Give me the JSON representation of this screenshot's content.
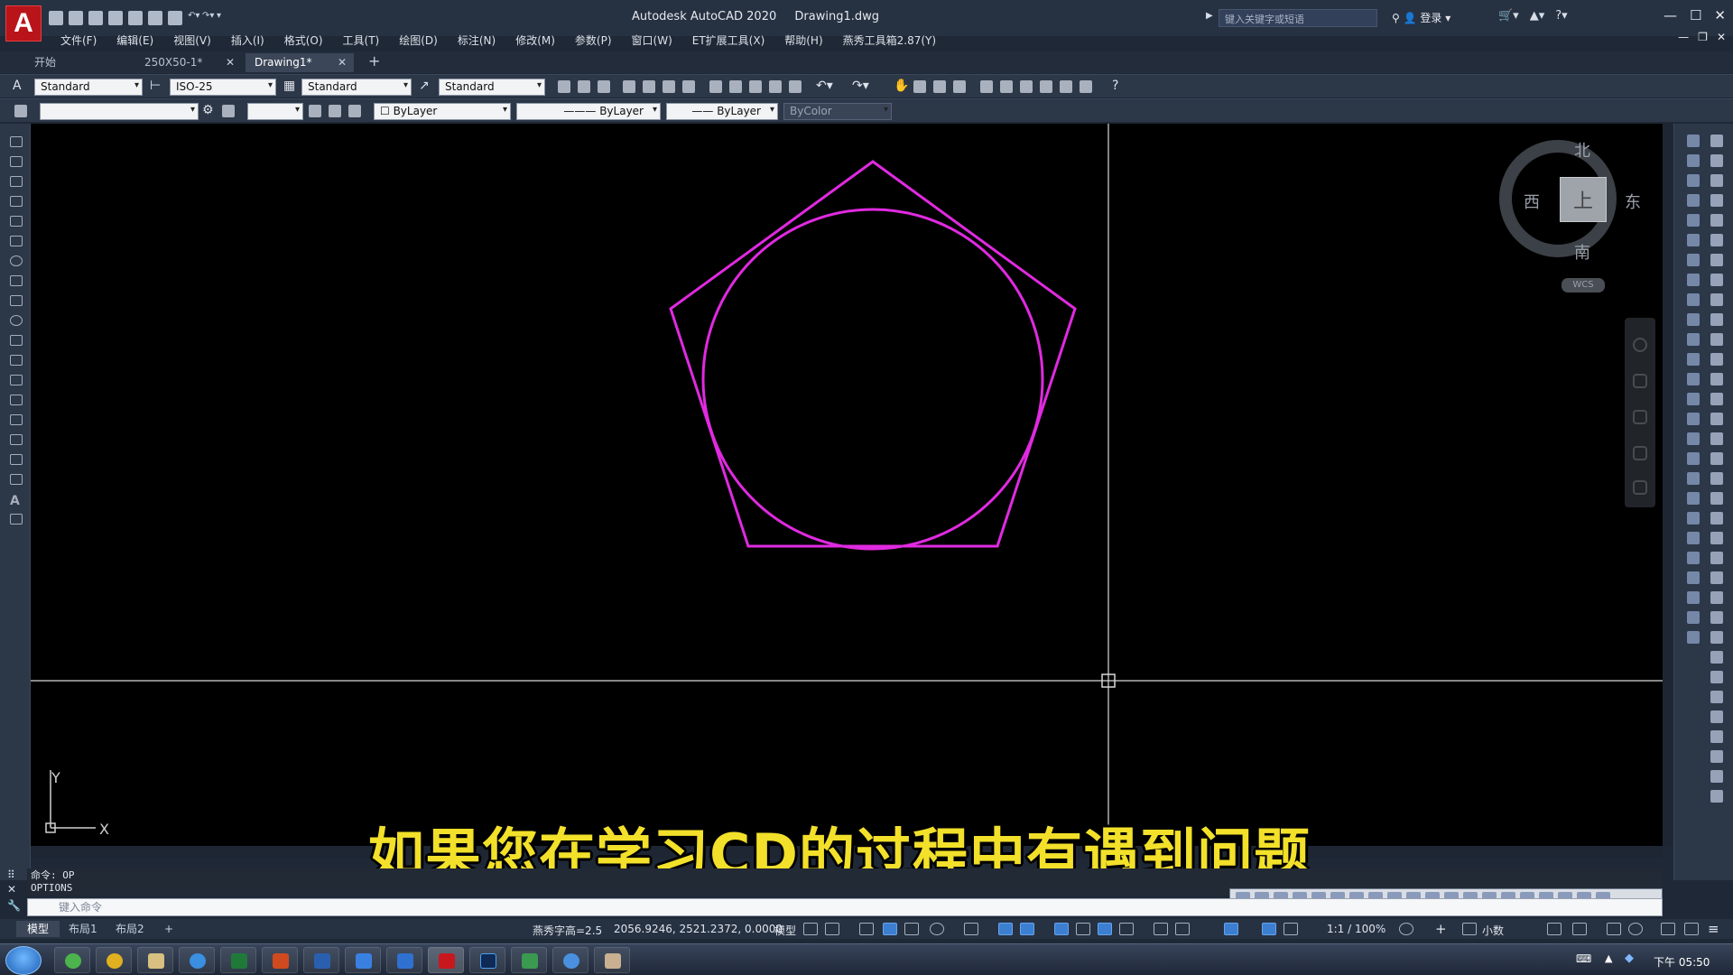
{
  "window": {
    "app_name": "Autodesk AutoCAD 2020",
    "file_name": "Drawing1.dwg",
    "search_placeholder": "键入关键字或短语",
    "login_label": "登录"
  },
  "menu": [
    "文件(F)",
    "编辑(E)",
    "视图(V)",
    "插入(I)",
    "格式(O)",
    "工具(T)",
    "绘图(D)",
    "标注(N)",
    "修改(M)",
    "参数(P)",
    "窗口(W)",
    "ET扩展工具(X)",
    "帮助(H)",
    "燕秀工具箱2.87(Y)"
  ],
  "tabs": [
    {
      "label": "开始"
    },
    {
      "label": "250X50-1*"
    },
    {
      "label": "Drawing1*"
    }
  ],
  "toolbar1": {
    "text_style": "Standard",
    "dim_style": "ISO-25",
    "table_style": "Standard",
    "multileader_style": "Standard"
  },
  "toolbar2": {
    "layer": "",
    "color": "ByLayer",
    "linetype": "ByLayer",
    "lineweight": "ByLayer",
    "plot_style": "ByColor"
  },
  "viewcube": {
    "north": "北",
    "south": "南",
    "east": "东",
    "west": "西",
    "face": "上",
    "wcs": "WCS"
  },
  "ucs": {
    "x_label": "X",
    "y_label": "Y"
  },
  "drawing": {
    "stroke_color": "#e02ae0",
    "crosshair_color": "#d8d8d8"
  },
  "subtitle": "如果您在学习CD的过程中有遇到问题",
  "command": {
    "history_line1": "命令: OP",
    "history_line2": "OPTIONS",
    "prompt_placeholder": "键入命令"
  },
  "layout_tabs": [
    "模型",
    "布局1",
    "布局2"
  ],
  "status": {
    "text_height": "燕秀字高=2.5",
    "coordinates": "2056.9246, 2521.2372, 0.0000",
    "model_label": "模型",
    "scale": "1:1 / 100%",
    "units": "小数"
  },
  "taskbar": {
    "clock": "下午 05:50"
  }
}
